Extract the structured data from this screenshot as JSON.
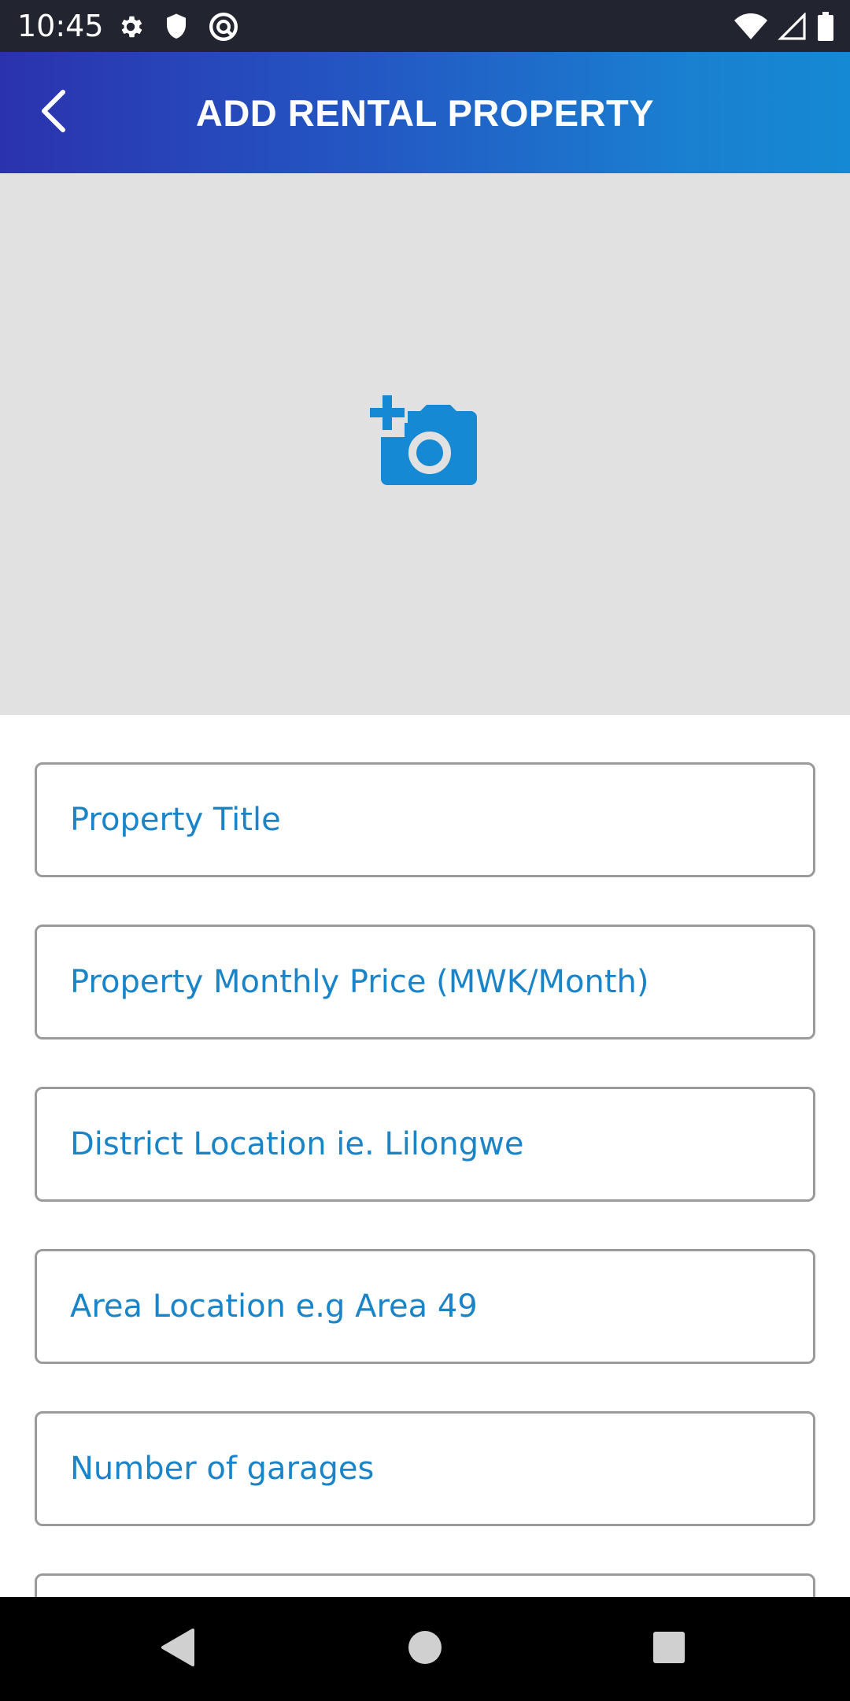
{
  "status_bar": {
    "time": "10:45",
    "left_icons": [
      "settings-icon",
      "shield-icon",
      "vpn-icon"
    ],
    "right_icons": [
      "wifi-icon",
      "signal-icon",
      "battery-icon"
    ]
  },
  "app_bar": {
    "title": "ADD RENTAL PROPERTY",
    "back_icon": "chevron-left-icon"
  },
  "photo": {
    "icon": "add-a-photo-icon"
  },
  "form": {
    "fields": [
      {
        "placeholder": "Property Title"
      },
      {
        "placeholder": "Property Monthly Price (MWK/Month)"
      },
      {
        "placeholder": "District Location ie. Lilongwe"
      },
      {
        "placeholder": "Area Location e.g Area 49"
      },
      {
        "placeholder": "Number of garages"
      }
    ]
  },
  "nav_bar": {
    "buttons": [
      "back-triangle-icon",
      "home-circle-icon",
      "recents-square-icon"
    ]
  },
  "colors": {
    "accent": "#1a84c9",
    "status_bar": "#22252f",
    "photo_bg": "#e1e1e1",
    "app_bar_start": "#2b32ae",
    "app_bar_end": "#1589d3"
  }
}
